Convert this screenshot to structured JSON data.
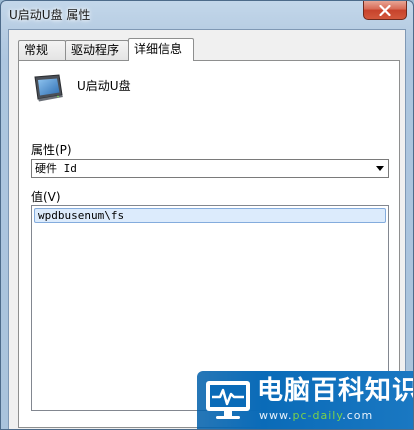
{
  "window": {
    "title": "U启动U盘 属性"
  },
  "tabs": [
    {
      "label": "常规"
    },
    {
      "label": "驱动程序"
    },
    {
      "label": "详细信息"
    }
  ],
  "device": {
    "icon": "usb-drive-icon",
    "name": "U启动U盘"
  },
  "property": {
    "label": "属性(P)",
    "selected": "硬件 Id"
  },
  "value": {
    "label": "值(V)",
    "items": [
      "wpdbusenum\\fs"
    ]
  },
  "watermark": {
    "title": "电脑百科知识",
    "url_prefix": "www.",
    "url_main": "pc-daily",
    "url_suffix": ".com",
    "colors": {
      "background": "#0a6bb8",
      "accent": "#7ad24a"
    }
  }
}
